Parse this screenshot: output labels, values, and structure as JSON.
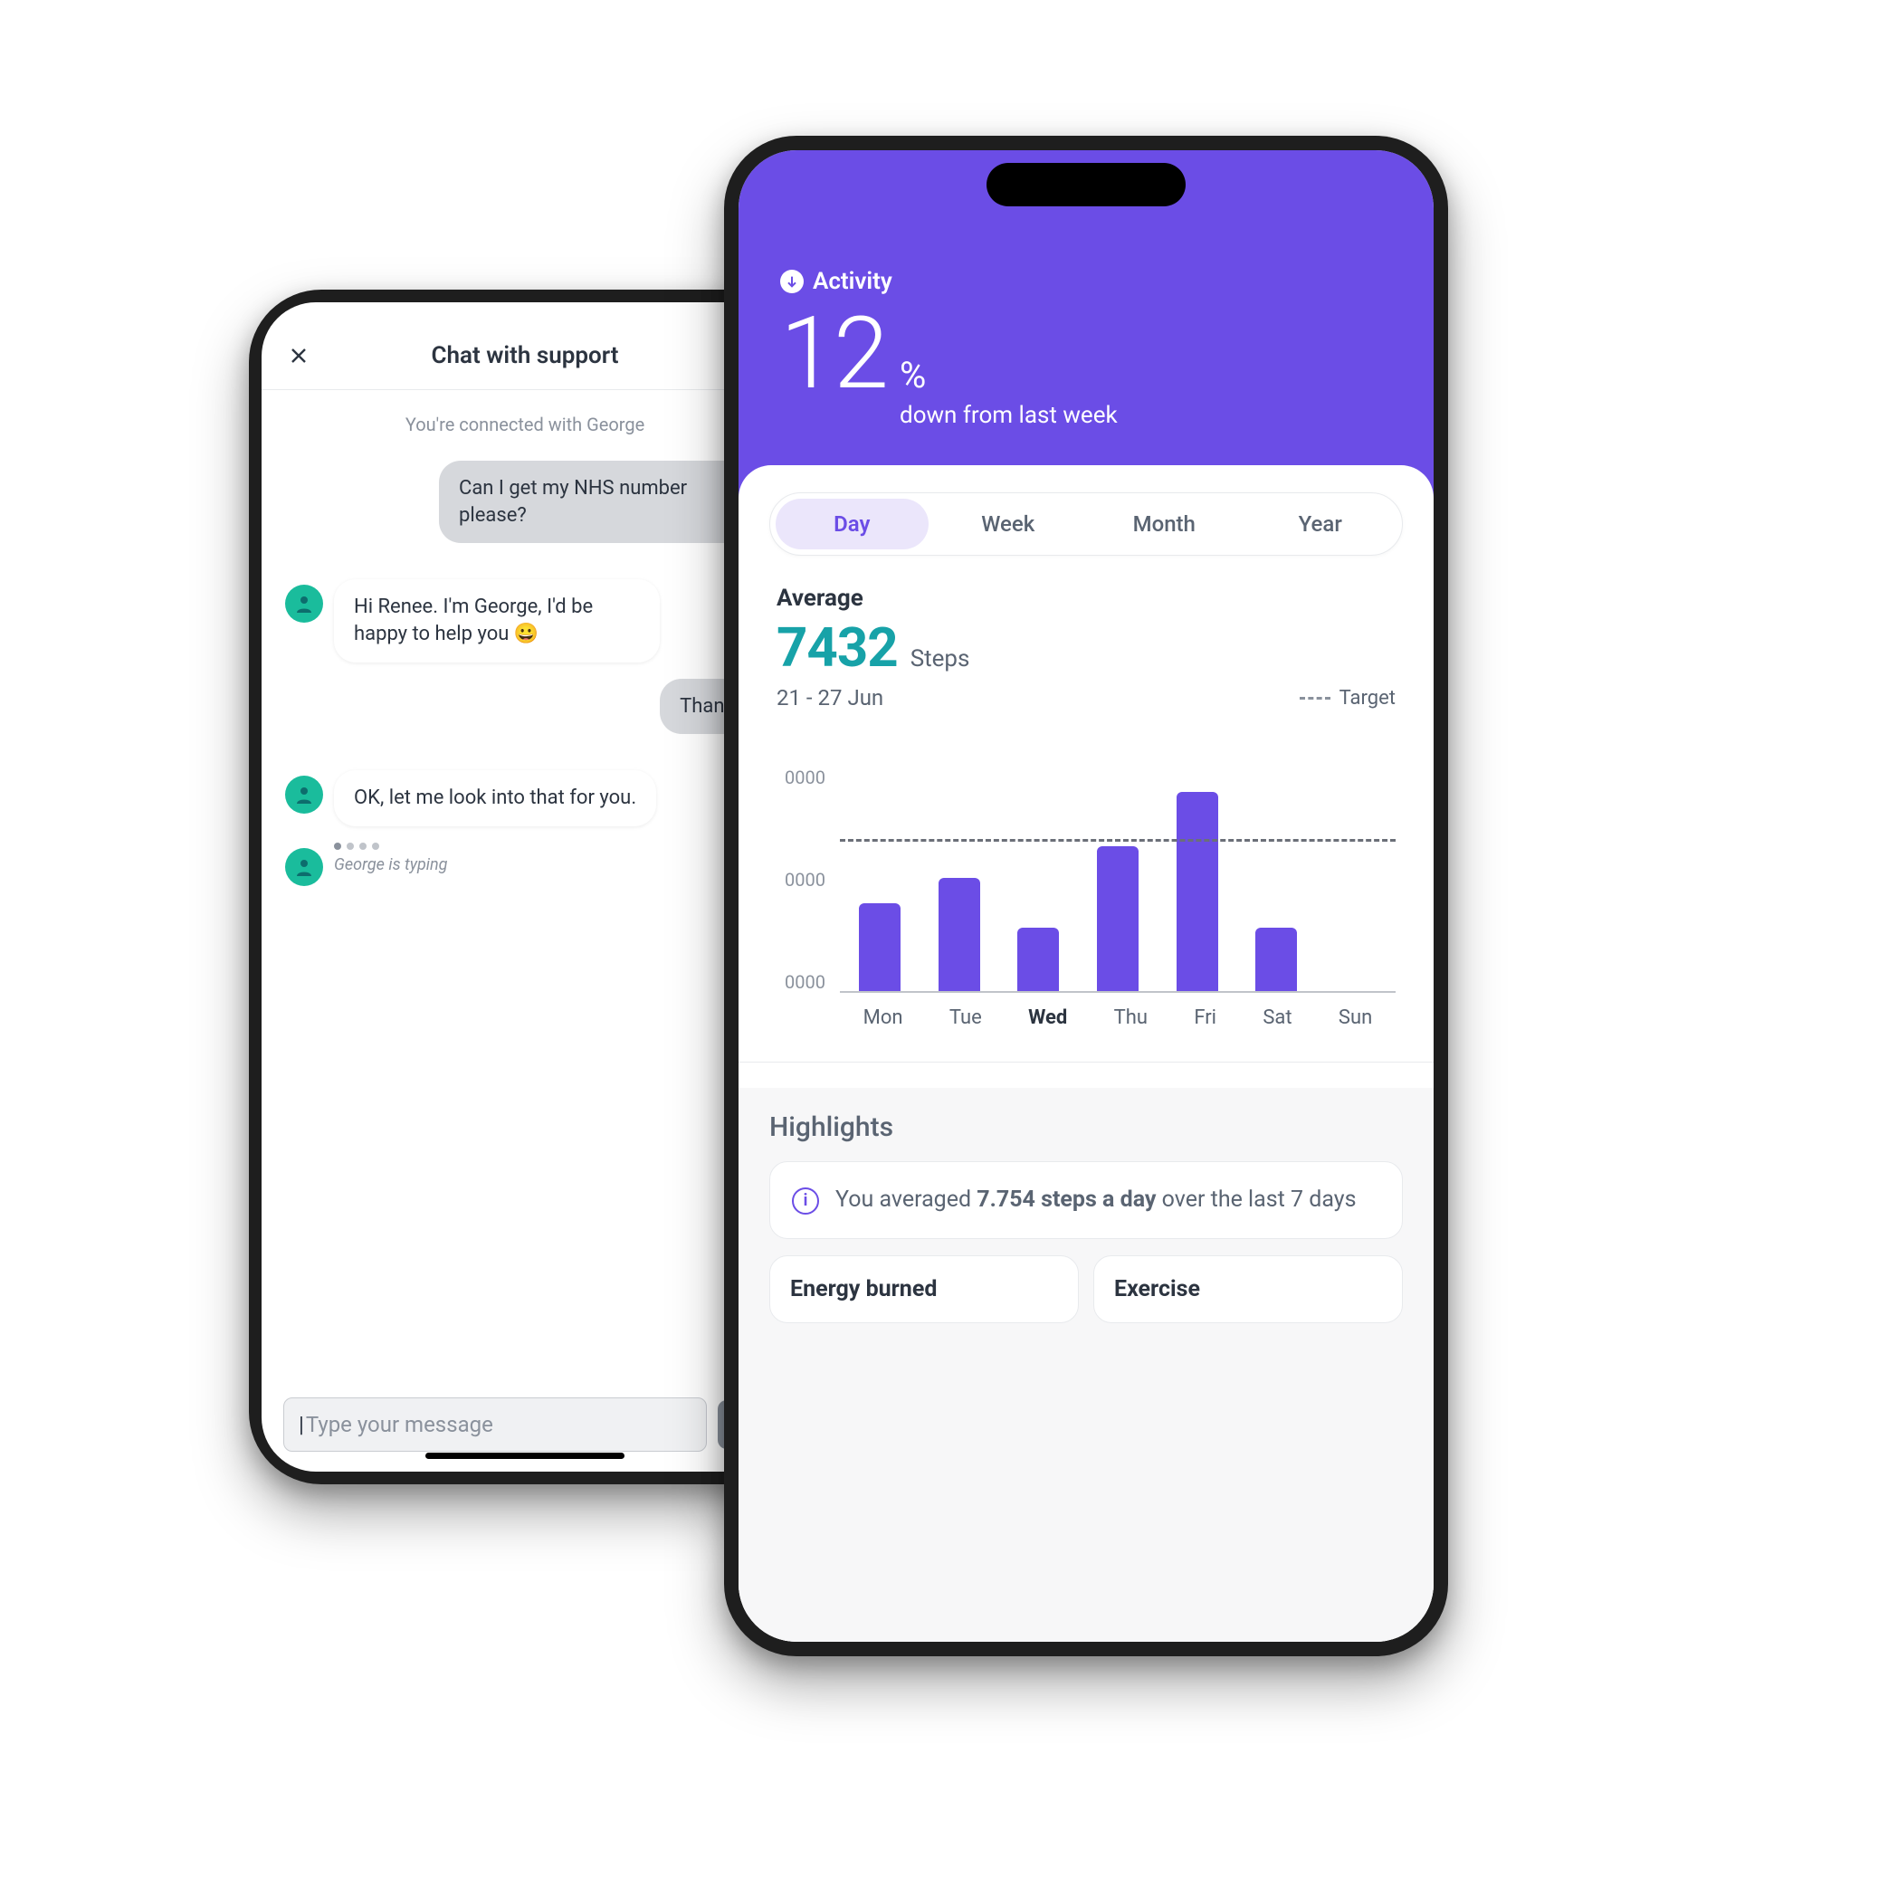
{
  "chat": {
    "title": "Chat with support",
    "status": "You're connected with George",
    "messages": [
      {
        "side": "out",
        "text": "Can I get my NHS number please?"
      },
      {
        "side": "in",
        "text": "Hi Renee. I'm George, I'd be happy to help you 😀"
      },
      {
        "side": "out",
        "text": "Thanks"
      },
      {
        "side": "in",
        "text": "OK, let me look into that for you."
      }
    ],
    "typing_label": "George is typing",
    "input_placeholder": "Type your message"
  },
  "activity": {
    "hero_label": "Activity",
    "hero_number": "12",
    "hero_pct": "%",
    "hero_sub": "down from last week",
    "tabs": [
      "Day",
      "Week",
      "Month",
      "Year"
    ],
    "active_tab": 0,
    "avg_label": "Average",
    "avg_value": "7432",
    "avg_unit": "Steps",
    "range": "21 - 27 Jun",
    "target_label": "Target",
    "y_tick": "0000",
    "highlights_title": "Highlights",
    "highlight_prefix": "You averaged ",
    "highlight_bold": "7.754 steps a day",
    "highlight_suffix": " over the last 7 days",
    "mini_cards": [
      "Energy burned",
      "Exercise"
    ]
  },
  "chart_data": {
    "type": "bar",
    "categories": [
      "Mon",
      "Tue",
      "Wed",
      "Thu",
      "Fri",
      "Sat",
      "Sun"
    ],
    "values": [
      5800,
      7500,
      4200,
      9600,
      13200,
      4200,
      0
    ],
    "today_index": 2,
    "target": 10000,
    "ylim": [
      0,
      15000
    ],
    "y_tick_labels": [
      "0000",
      "0000",
      "0000"
    ],
    "ylabel": "",
    "xlabel": "",
    "title": ""
  }
}
